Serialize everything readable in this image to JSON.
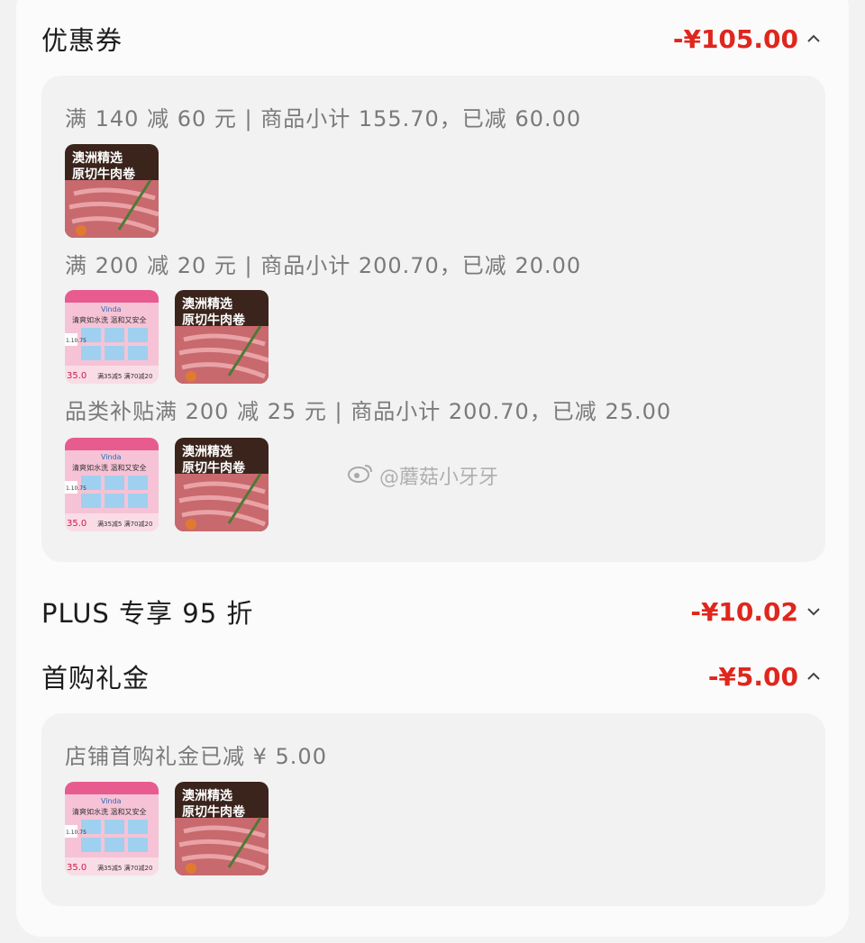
{
  "coupon": {
    "title": "优惠券",
    "amount": "-¥105.00",
    "rules": [
      {
        "text": "满 140 减 60 元 | 商品小计 155.70，已减 60.00",
        "products": [
          "beef"
        ]
      },
      {
        "text": "满 200 减 20 元 | 商品小计 200.70，已减 20.00",
        "products": [
          "tissue",
          "beef"
        ]
      },
      {
        "text": "品类补贴满 200 减 25 元 | 商品小计 200.70，已减 25.00",
        "products": [
          "tissue",
          "beef"
        ]
      }
    ]
  },
  "plus": {
    "title": "PLUS 专享 95 折",
    "amount": "-¥10.02"
  },
  "first_gift": {
    "title": "首购礼金",
    "amount": "-¥5.00",
    "rules": [
      {
        "text": "店铺首购礼金已减 ¥ 5.00",
        "products": [
          "tissue",
          "beef"
        ]
      }
    ]
  },
  "products": {
    "beef": {
      "line1": "澳洲精选",
      "line2": "原切牛肉卷"
    },
    "tissue": {
      "brand": "Vinda",
      "caption": "清爽如水洗 温和又安全",
      "badge": "1.10.75",
      "price": "35.0",
      "promo": "满35减5 满70减20"
    }
  },
  "watermark": "@蘑菇小牙牙",
  "colors": {
    "accent": "#e0261d",
    "panel": "#f2f2f2",
    "card": "#fbfbfb"
  }
}
